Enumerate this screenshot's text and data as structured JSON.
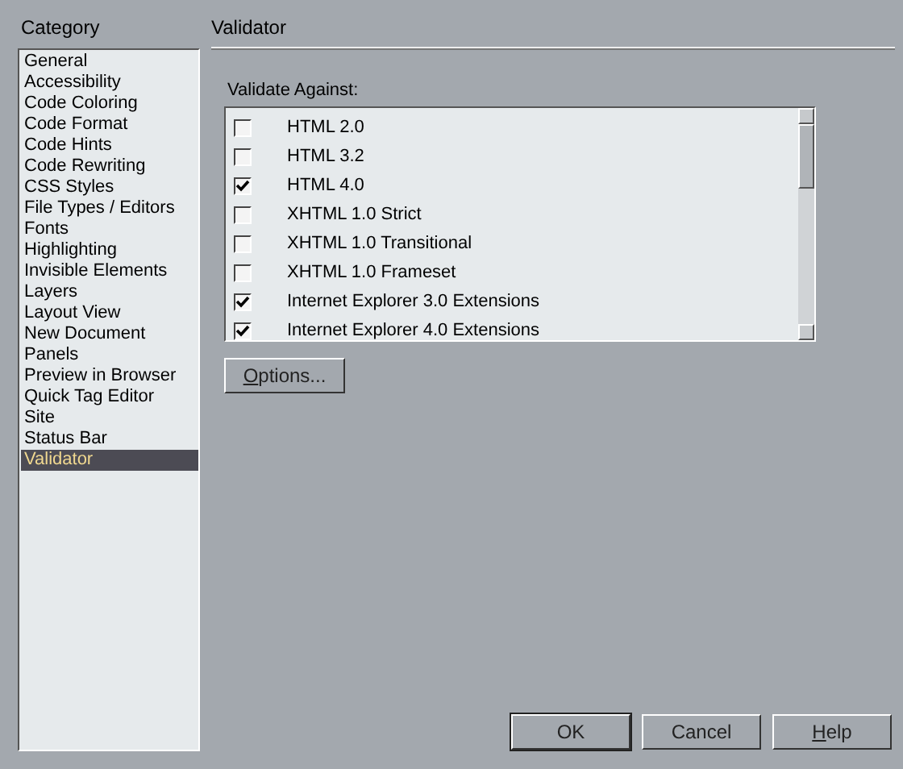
{
  "sidebar": {
    "title": "Category",
    "items": [
      {
        "label": "General",
        "selected": false
      },
      {
        "label": "Accessibility",
        "selected": false
      },
      {
        "label": "Code Coloring",
        "selected": false
      },
      {
        "label": "Code Format",
        "selected": false
      },
      {
        "label": "Code Hints",
        "selected": false
      },
      {
        "label": "Code Rewriting",
        "selected": false
      },
      {
        "label": "CSS Styles",
        "selected": false
      },
      {
        "label": "File Types / Editors",
        "selected": false
      },
      {
        "label": "Fonts",
        "selected": false
      },
      {
        "label": "Highlighting",
        "selected": false
      },
      {
        "label": "Invisible Elements",
        "selected": false
      },
      {
        "label": "Layers",
        "selected": false
      },
      {
        "label": "Layout View",
        "selected": false
      },
      {
        "label": "New Document",
        "selected": false
      },
      {
        "label": "Panels",
        "selected": false
      },
      {
        "label": "Preview in Browser",
        "selected": false
      },
      {
        "label": "Quick Tag Editor",
        "selected": false
      },
      {
        "label": "Site",
        "selected": false
      },
      {
        "label": "Status Bar",
        "selected": false
      },
      {
        "label": "Validator",
        "selected": true
      }
    ]
  },
  "panel": {
    "title": "Validator",
    "list_label": "Validate Against:",
    "options": [
      {
        "label": "HTML 2.0",
        "checked": false
      },
      {
        "label": "HTML 3.2",
        "checked": false
      },
      {
        "label": "HTML 4.0",
        "checked": true
      },
      {
        "label": "XHTML 1.0 Strict",
        "checked": false
      },
      {
        "label": "XHTML 1.0 Transitional",
        "checked": false
      },
      {
        "label": "XHTML 1.0 Frameset",
        "checked": false
      },
      {
        "label": "Internet Explorer 3.0 Extensions",
        "checked": true
      },
      {
        "label": "Internet Explorer 4.0 Extensions",
        "checked": true
      }
    ],
    "options_button": {
      "label": "Options...",
      "underline_first": true
    }
  },
  "buttons": [
    {
      "label": "OK",
      "default": true,
      "underline_first": false
    },
    {
      "label": "Cancel",
      "default": false,
      "underline_first": false
    },
    {
      "label": "Help",
      "default": false,
      "underline_first": true
    }
  ]
}
